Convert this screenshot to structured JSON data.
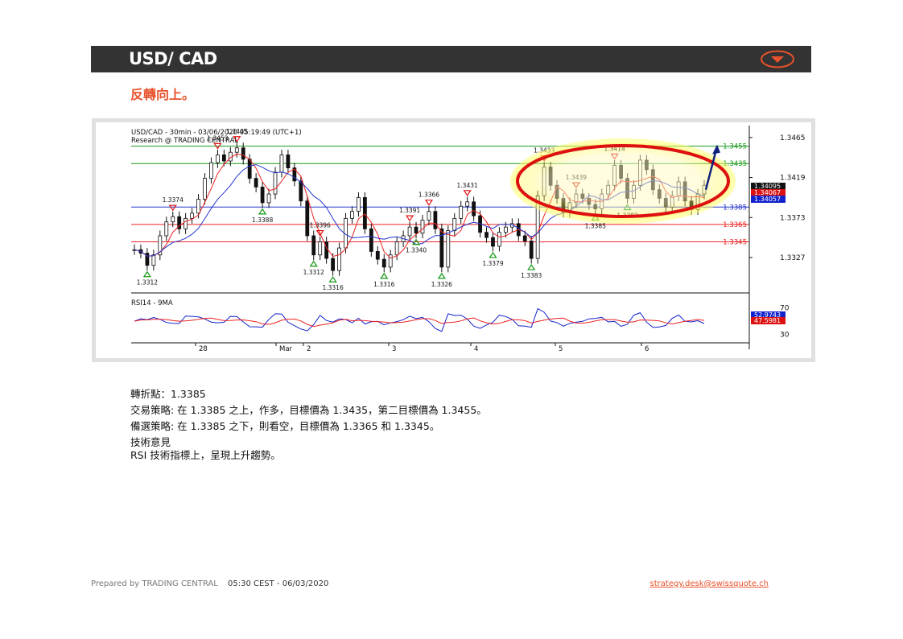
{
  "header": {
    "title": "USD/ CAD",
    "accent_color": "#e8512a",
    "toggle_icon": "chevron-down-circle-icon"
  },
  "subtitle": "反轉向上。",
  "chart_info": {
    "title_line1": "USD/CAD - 30min - 03/06/2020 05:19:49 (UTC+1)",
    "title_line2": "Research @ TRADING CENTRAL",
    "rsi_label": "RSI14 - 9MA"
  },
  "chart_data": {
    "type": "line",
    "title": "USD/CAD - 30min - 03/06/2020 05:19:49 (UTC+1)",
    "ylim": [
      1.329,
      1.3475
    ],
    "y_ticks": [
      1.3465,
      1.3419,
      1.3373,
      1.3327
    ],
    "x_ticks": [
      "28",
      "Mar",
      "2",
      "3",
      "4",
      "5",
      "6"
    ],
    "levels": [
      {
        "value": 1.3455,
        "label": "1.3455",
        "color": "#1a9a1a"
      },
      {
        "value": 1.3435,
        "label": "1.3435",
        "color": "#1a9a1a"
      },
      {
        "value": 1.3385,
        "label": "1.3385",
        "color": "#2233cc"
      },
      {
        "value": 1.3365,
        "label": "1.3365",
        "color": "#ee2222"
      },
      {
        "value": 1.3345,
        "label": "1.3345",
        "color": "#ee2222"
      }
    ],
    "price_tags": [
      {
        "label": "1.34095",
        "color": "#111111"
      },
      {
        "label": "1.34067",
        "color": "#dd1111"
      },
      {
        "label": "1.34057",
        "color": "#1122cc"
      }
    ],
    "swing_labels": [
      {
        "label": "1.3312",
        "type": "low"
      },
      {
        "label": "1.3374",
        "type": "high"
      },
      {
        "label": "1.3453",
        "type": "high"
      },
      {
        "label": "1.3445",
        "type": "high"
      },
      {
        "label": "1.3388",
        "type": "low"
      },
      {
        "label": "1.3312",
        "type": "low"
      },
      {
        "label": "1.3396",
        "type": "high"
      },
      {
        "label": "1.3316",
        "type": "low"
      },
      {
        "label": "1.3316",
        "type": "low"
      },
      {
        "label": "1.3391",
        "type": "high"
      },
      {
        "label": "1.3340",
        "type": "low"
      },
      {
        "label": "1.3366",
        "type": "high"
      },
      {
        "label": "1.3326",
        "type": "low"
      },
      {
        "label": "1.3431",
        "type": "high"
      },
      {
        "label": "1.3379",
        "type": "low"
      },
      {
        "label": "1.3383",
        "type": "low"
      },
      {
        "label": "1.3433",
        "type": "high"
      },
      {
        "label": "1.3439",
        "type": "high"
      },
      {
        "label": "1.3385",
        "type": "low"
      },
      {
        "label": "1.3414",
        "type": "high"
      },
      {
        "label": "1.3382",
        "type": "low"
      }
    ],
    "close_series": [
      1.3336,
      1.3332,
      1.3318,
      1.333,
      1.3352,
      1.3368,
      1.3374,
      1.336,
      1.3372,
      1.3378,
      1.3394,
      1.3418,
      1.3436,
      1.3445,
      1.3438,
      1.3448,
      1.3453,
      1.344,
      1.3418,
      1.3408,
      1.339,
      1.34,
      1.3425,
      1.3445,
      1.343,
      1.3415,
      1.3392,
      1.3352,
      1.333,
      1.3345,
      1.3326,
      1.3312,
      1.3338,
      1.3372,
      1.338,
      1.3396,
      1.336,
      1.3334,
      1.3325,
      1.3316,
      1.333,
      1.3345,
      1.3352,
      1.3362,
      1.3355,
      1.337,
      1.338,
      1.336,
      1.3316,
      1.3358,
      1.3372,
      1.3386,
      1.3391,
      1.3375,
      1.3356,
      1.335,
      1.334,
      1.3356,
      1.3362,
      1.3366,
      1.3352,
      1.3346,
      1.3326,
      1.3398,
      1.3431,
      1.341,
      1.3395,
      1.3379,
      1.339,
      1.34,
      1.3395,
      1.3388,
      1.3383,
      1.34,
      1.341,
      1.3433,
      1.3418,
      1.3395,
      1.341,
      1.3439,
      1.3428,
      1.3405,
      1.3395,
      1.3385,
      1.3398,
      1.3414,
      1.3392,
      1.3382,
      1.34,
      1.341
    ],
    "rsi": {
      "levels": [
        70,
        30
      ],
      "values": [
        {
          "label": "52.9743",
          "series": "RSI",
          "color": "#1122cc"
        },
        {
          "label": "47.5981",
          "series": "9MA",
          "color": "#dd1111"
        }
      ]
    },
    "forecast_arrow": {
      "from": 1.3405,
      "to": 1.3455,
      "color": "#10237a"
    },
    "highlight": "ellipse around recent range"
  },
  "analysis": {
    "pivot": "轉折點：1.3385",
    "strategy": "交易策略: 在 1.3385 之上，作多，目標價為  1.3435，第二目標價為  1.3455。",
    "alternative": "備選策略: 在 1.3385 之下，則看空，目標價為  1.3365 和 1.3345。",
    "tech_heading": "技術意見",
    "tech_comment": "RSI 技術指標上，呈現上升趨勢。"
  },
  "footer": {
    "prepared": "Prepared by TRADING CENTRAL",
    "timestamp": "05:30 CEST - 06/03/2020",
    "email": "strategy.desk@swissquote.ch"
  }
}
